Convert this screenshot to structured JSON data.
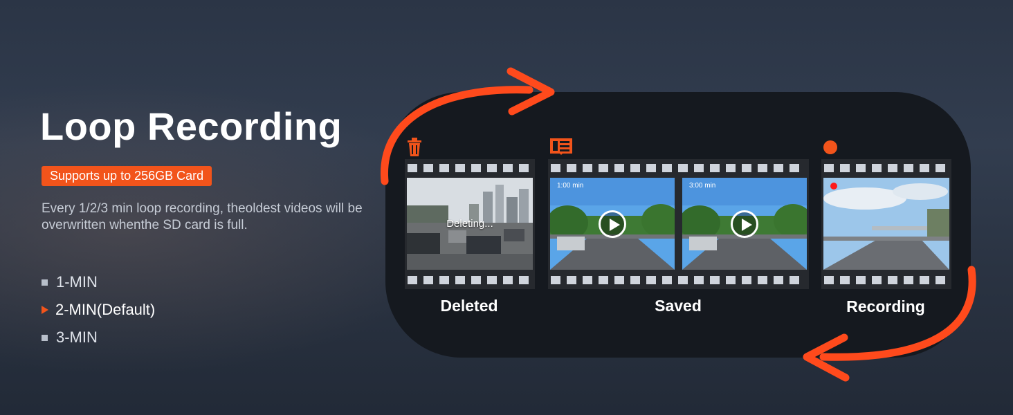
{
  "heading": "Loop Recording",
  "badge": "Supports up to 256GB Card",
  "description": "Every 1/2/3 min loop recording, theoldest videos will be overwritten whenthe SD card is full.",
  "options": [
    {
      "label": "1-MIN",
      "selected": false
    },
    {
      "label": "2-MIN(Default)",
      "selected": true
    },
    {
      "label": "3-MIN",
      "selected": false
    }
  ],
  "colors": {
    "accent": "#f2541b",
    "panel": "#15191f",
    "background": "#2b3546"
  },
  "stages": {
    "deleted": {
      "caption": "Deleted",
      "overlay_text": "Deleting...",
      "icon": "trash-icon"
    },
    "saved": {
      "caption": "Saved",
      "icon": "sd-card-icon",
      "clips": [
        {
          "time": "1:00 min"
        },
        {
          "time": "3:00 min"
        }
      ]
    },
    "recording": {
      "caption": "Recording",
      "icon": "record-dot-icon"
    }
  }
}
